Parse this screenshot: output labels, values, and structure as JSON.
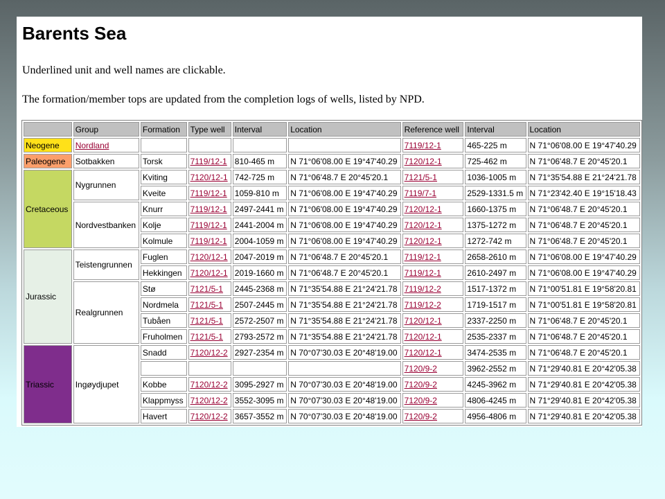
{
  "page": {
    "title": "Barents Sea",
    "note1": "Underlined unit and well names are clickable.",
    "note2": "The formation/member tops are updated from the completion logs of wells, listed by NPD."
  },
  "colors": {
    "neogene": "#ffe119",
    "paleogene": "#fb9f6b",
    "cretaceous": "#c5d862",
    "jurassic": "#e6f0e6",
    "triassic": "#7f2d8c",
    "link": "#990033",
    "header": "#c0c0c0"
  },
  "table": {
    "headers": [
      "",
      "Group",
      "Formation",
      "Type well",
      "Interval",
      "Location",
      "Reference well",
      "Interval",
      "Location"
    ],
    "systems": [
      {
        "name": "Neogene",
        "key": "neogene",
        "rows": 1
      },
      {
        "name": "Paleogene",
        "key": "paleogene",
        "rows": 1
      },
      {
        "name": "Cretaceous",
        "key": "cretaceous",
        "rows": 5
      },
      {
        "name": "Jurassic",
        "key": "jurassic",
        "rows": 6
      },
      {
        "name": "Triassic",
        "key": "triassic",
        "rows": 5
      }
    ],
    "groups": [
      {
        "name": "Nordland",
        "rows": 1,
        "link": true
      },
      {
        "name": "Sotbakken",
        "rows": 1,
        "link": false
      },
      {
        "name": "Nygrunnen",
        "rows": 2,
        "link": false
      },
      {
        "name": "Nordvestbanken",
        "rows": 3,
        "link": false
      },
      {
        "name": "Teistengrunnen",
        "rows": 2,
        "link": false
      },
      {
        "name": "Realgrunnen",
        "rows": 4,
        "link": false
      },
      {
        "name": "Ingøydjupet",
        "rows": 5,
        "link": false
      }
    ],
    "rows": [
      {
        "formation": "",
        "type_well": "",
        "interval": "",
        "location": "",
        "ref_well": "7119/12-1",
        "ref_interval": "465-225 m",
        "ref_location": "N 71°06'08.00 E 19°47'40.29"
      },
      {
        "formation": "Torsk",
        "type_well": "7119/12-1",
        "interval": "810-465 m",
        "location": "N 71°06'08.00 E 19°47'40.29",
        "ref_well": "7120/12-1",
        "ref_interval": "725-462 m",
        "ref_location": "N 71°06'48.7 E 20°45'20.1"
      },
      {
        "formation": "Kviting",
        "type_well": "7120/12-1",
        "interval": "742-725 m",
        "location": "N 71°06'48.7 E 20°45'20.1",
        "ref_well": "7121/5-1",
        "ref_interval": "1036-1005 m",
        "ref_location": "N 71°35'54.88 E 21°24'21.78"
      },
      {
        "formation": "Kveite",
        "type_well": "7119/12-1",
        "interval": "1059-810 m",
        "location": "N 71°06'08.00 E 19°47'40.29",
        "ref_well": "7119/7-1",
        "ref_interval": "2529-1331.5 m",
        "ref_location": "N 71°23'42.40 E 19°15'18.43"
      },
      {
        "formation": "Knurr",
        "type_well": "7119/12-1",
        "interval": "2497-2441 m",
        "location": "N 71°06'08.00 E 19°47'40.29",
        "ref_well": "7120/12-1",
        "ref_interval": "1660-1375 m",
        "ref_location": "N 71°06'48.7 E 20°45'20.1"
      },
      {
        "formation": "Kolje",
        "type_well": "7119/12-1",
        "interval": "2441-2004 m",
        "location": "N 71°06'08.00 E 19°47'40.29",
        "ref_well": "7120/12-1",
        "ref_interval": "1375-1272 m",
        "ref_location": "N 71°06'48.7 E 20°45'20.1"
      },
      {
        "formation": "Kolmule",
        "type_well": "7119/12-1",
        "interval": "2004-1059 m",
        "location": "N 71°06'08.00 E 19°47'40.29",
        "ref_well": "7120/12-1",
        "ref_interval": "1272-742 m",
        "ref_location": "N 71°06'48.7 E 20°45'20.1"
      },
      {
        "formation": "Fuglen",
        "type_well": "7120/12-1",
        "interval": "2047-2019 m",
        "location": "N 71°06'48.7 E 20°45'20.1",
        "ref_well": "7119/12-1",
        "ref_interval": "2658-2610 m",
        "ref_location": "N 71°06'08.00 E 19°47'40.29"
      },
      {
        "formation": "Hekkingen",
        "type_well": "7120/12-1",
        "interval": "2019-1660 m",
        "location": "N 71°06'48.7 E 20°45'20.1",
        "ref_well": "7119/12-1",
        "ref_interval": "2610-2497 m",
        "ref_location": "N 71°06'08.00 E 19°47'40.29"
      },
      {
        "formation": "Stø",
        "type_well": "7121/5-1",
        "interval": "2445-2368 m",
        "location": "N 71°35'54.88 E 21°24'21.78",
        "ref_well": "7119/12-2",
        "ref_interval": "1517-1372 m",
        "ref_location": "N 71°00'51.81 E 19°58'20.81"
      },
      {
        "formation": "Nordmela",
        "type_well": "7121/5-1",
        "interval": "2507-2445 m",
        "location": "N 71°35'54.88 E 21°24'21.78",
        "ref_well": "7119/12-2",
        "ref_interval": "1719-1517 m",
        "ref_location": "N 71°00'51.81 E 19°58'20.81"
      },
      {
        "formation": "Tubåen",
        "type_well": "7121/5-1",
        "interval": "2572-2507 m",
        "location": "N 71°35'54.88 E 21°24'21.78",
        "ref_well": "7120/12-1",
        "ref_interval": "2337-2250 m",
        "ref_location": "N 71°06'48.7 E 20°45'20.1"
      },
      {
        "formation": "Fruholmen",
        "type_well": "7121/5-1",
        "interval": "2793-2572 m",
        "location": "N 71°35'54.88 E 21°24'21.78",
        "ref_well": "7120/12-1",
        "ref_interval": "2535-2337 m",
        "ref_location": "N 71°06'48.7 E 20°45'20.1"
      },
      {
        "formation": "Snadd",
        "type_well": "7120/12-2",
        "interval": "2927-2354 m",
        "location": "N 70°07'30.03 E 20°48'19.00",
        "ref_well": "7120/12-1",
        "ref_interval": "3474-2535 m",
        "ref_location": "N 71°06'48.7 E 20°45'20.1"
      },
      {
        "formation": "",
        "type_well": "",
        "interval": "",
        "location": "",
        "ref_well": "7120/9-2",
        "ref_interval": "3962-2552 m",
        "ref_location": "N 71°29'40.81 E 20°42'05.38"
      },
      {
        "formation": "Kobbe",
        "type_well": "7120/12-2",
        "interval": "3095-2927 m",
        "location": "N 70°07'30.03 E 20°48'19.00",
        "ref_well": "7120/9-2",
        "ref_interval": "4245-3962 m",
        "ref_location": "N 71°29'40.81 E 20°42'05.38"
      },
      {
        "formation": "Klappmyss",
        "type_well": "7120/12-2",
        "interval": "3552-3095 m",
        "location": "N 70°07'30.03 E 20°48'19.00",
        "ref_well": "7120/9-2",
        "ref_interval": "4806-4245 m",
        "ref_location": "N 71°29'40.81 E 20°42'05.38"
      },
      {
        "formation": "Havert",
        "type_well": "7120/12-2",
        "interval": "3657-3552 m",
        "location": "N 70°07'30.03 E 20°48'19.00",
        "ref_well": "7120/9-2",
        "ref_interval": "4956-4806 m",
        "ref_location": "N 71°29'40.81 E 20°42'05.38"
      }
    ]
  }
}
